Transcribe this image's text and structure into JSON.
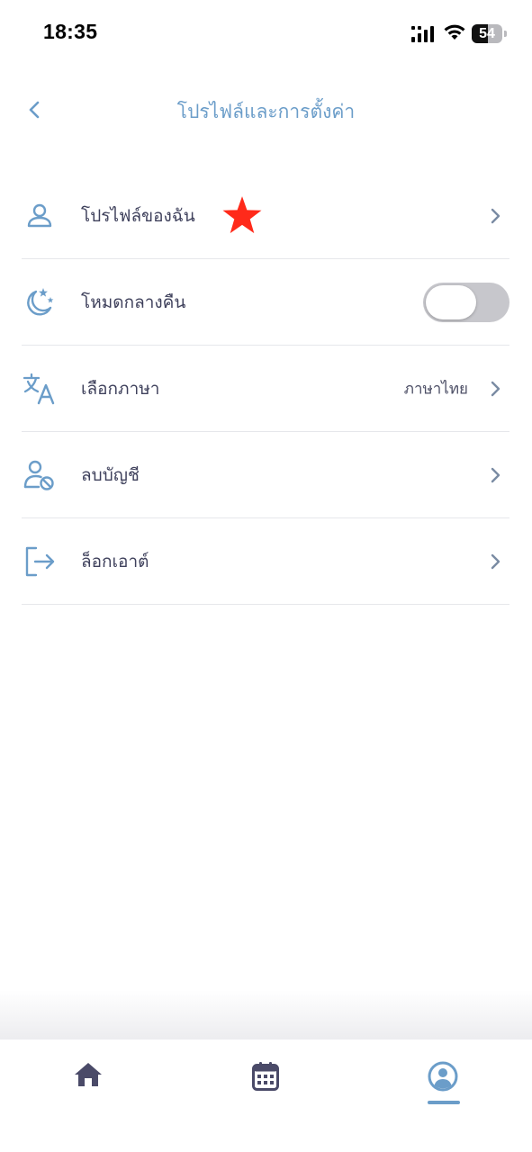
{
  "status_bar": {
    "time": "18:35",
    "battery_level": "54"
  },
  "header": {
    "back_icon": "chevron-left-icon",
    "title": "โปรไฟล์และการตั้งค่า"
  },
  "settings": [
    {
      "id": "my-profile",
      "icon": "user-icon",
      "label": "โปรไฟล์ของฉัน",
      "marker": "star",
      "trailing": "chevron"
    },
    {
      "id": "dark-mode",
      "icon": "moon-stars-icon",
      "label": "โหมดกลางคืน",
      "trailing": "toggle",
      "toggle_on": false
    },
    {
      "id": "language",
      "icon": "translate-icon",
      "label": "เลือกภาษา",
      "value": "ภาษาไทย",
      "trailing": "chevron"
    },
    {
      "id": "delete-account",
      "icon": "user-block-icon",
      "label": "ลบบัญชี",
      "trailing": "chevron"
    },
    {
      "id": "logout",
      "icon": "logout-icon",
      "label": "ล็อกเอาต์",
      "trailing": "chevron"
    }
  ],
  "bottom_nav": {
    "items": [
      {
        "id": "home",
        "icon": "home-icon",
        "active": false
      },
      {
        "id": "calendar",
        "icon": "calendar-icon",
        "active": false
      },
      {
        "id": "profile",
        "icon": "user-circle-icon",
        "active": true
      }
    ]
  },
  "colors": {
    "accent": "#6b9dc9",
    "icon": "#6b9dc9",
    "text": "#3f415c",
    "chevron": "#7a8ba3",
    "divider": "#e6e7eb",
    "nav_inactive": "#4a4a68",
    "star": "#ff2a1a",
    "toggle_off": "#c7c7cc"
  }
}
